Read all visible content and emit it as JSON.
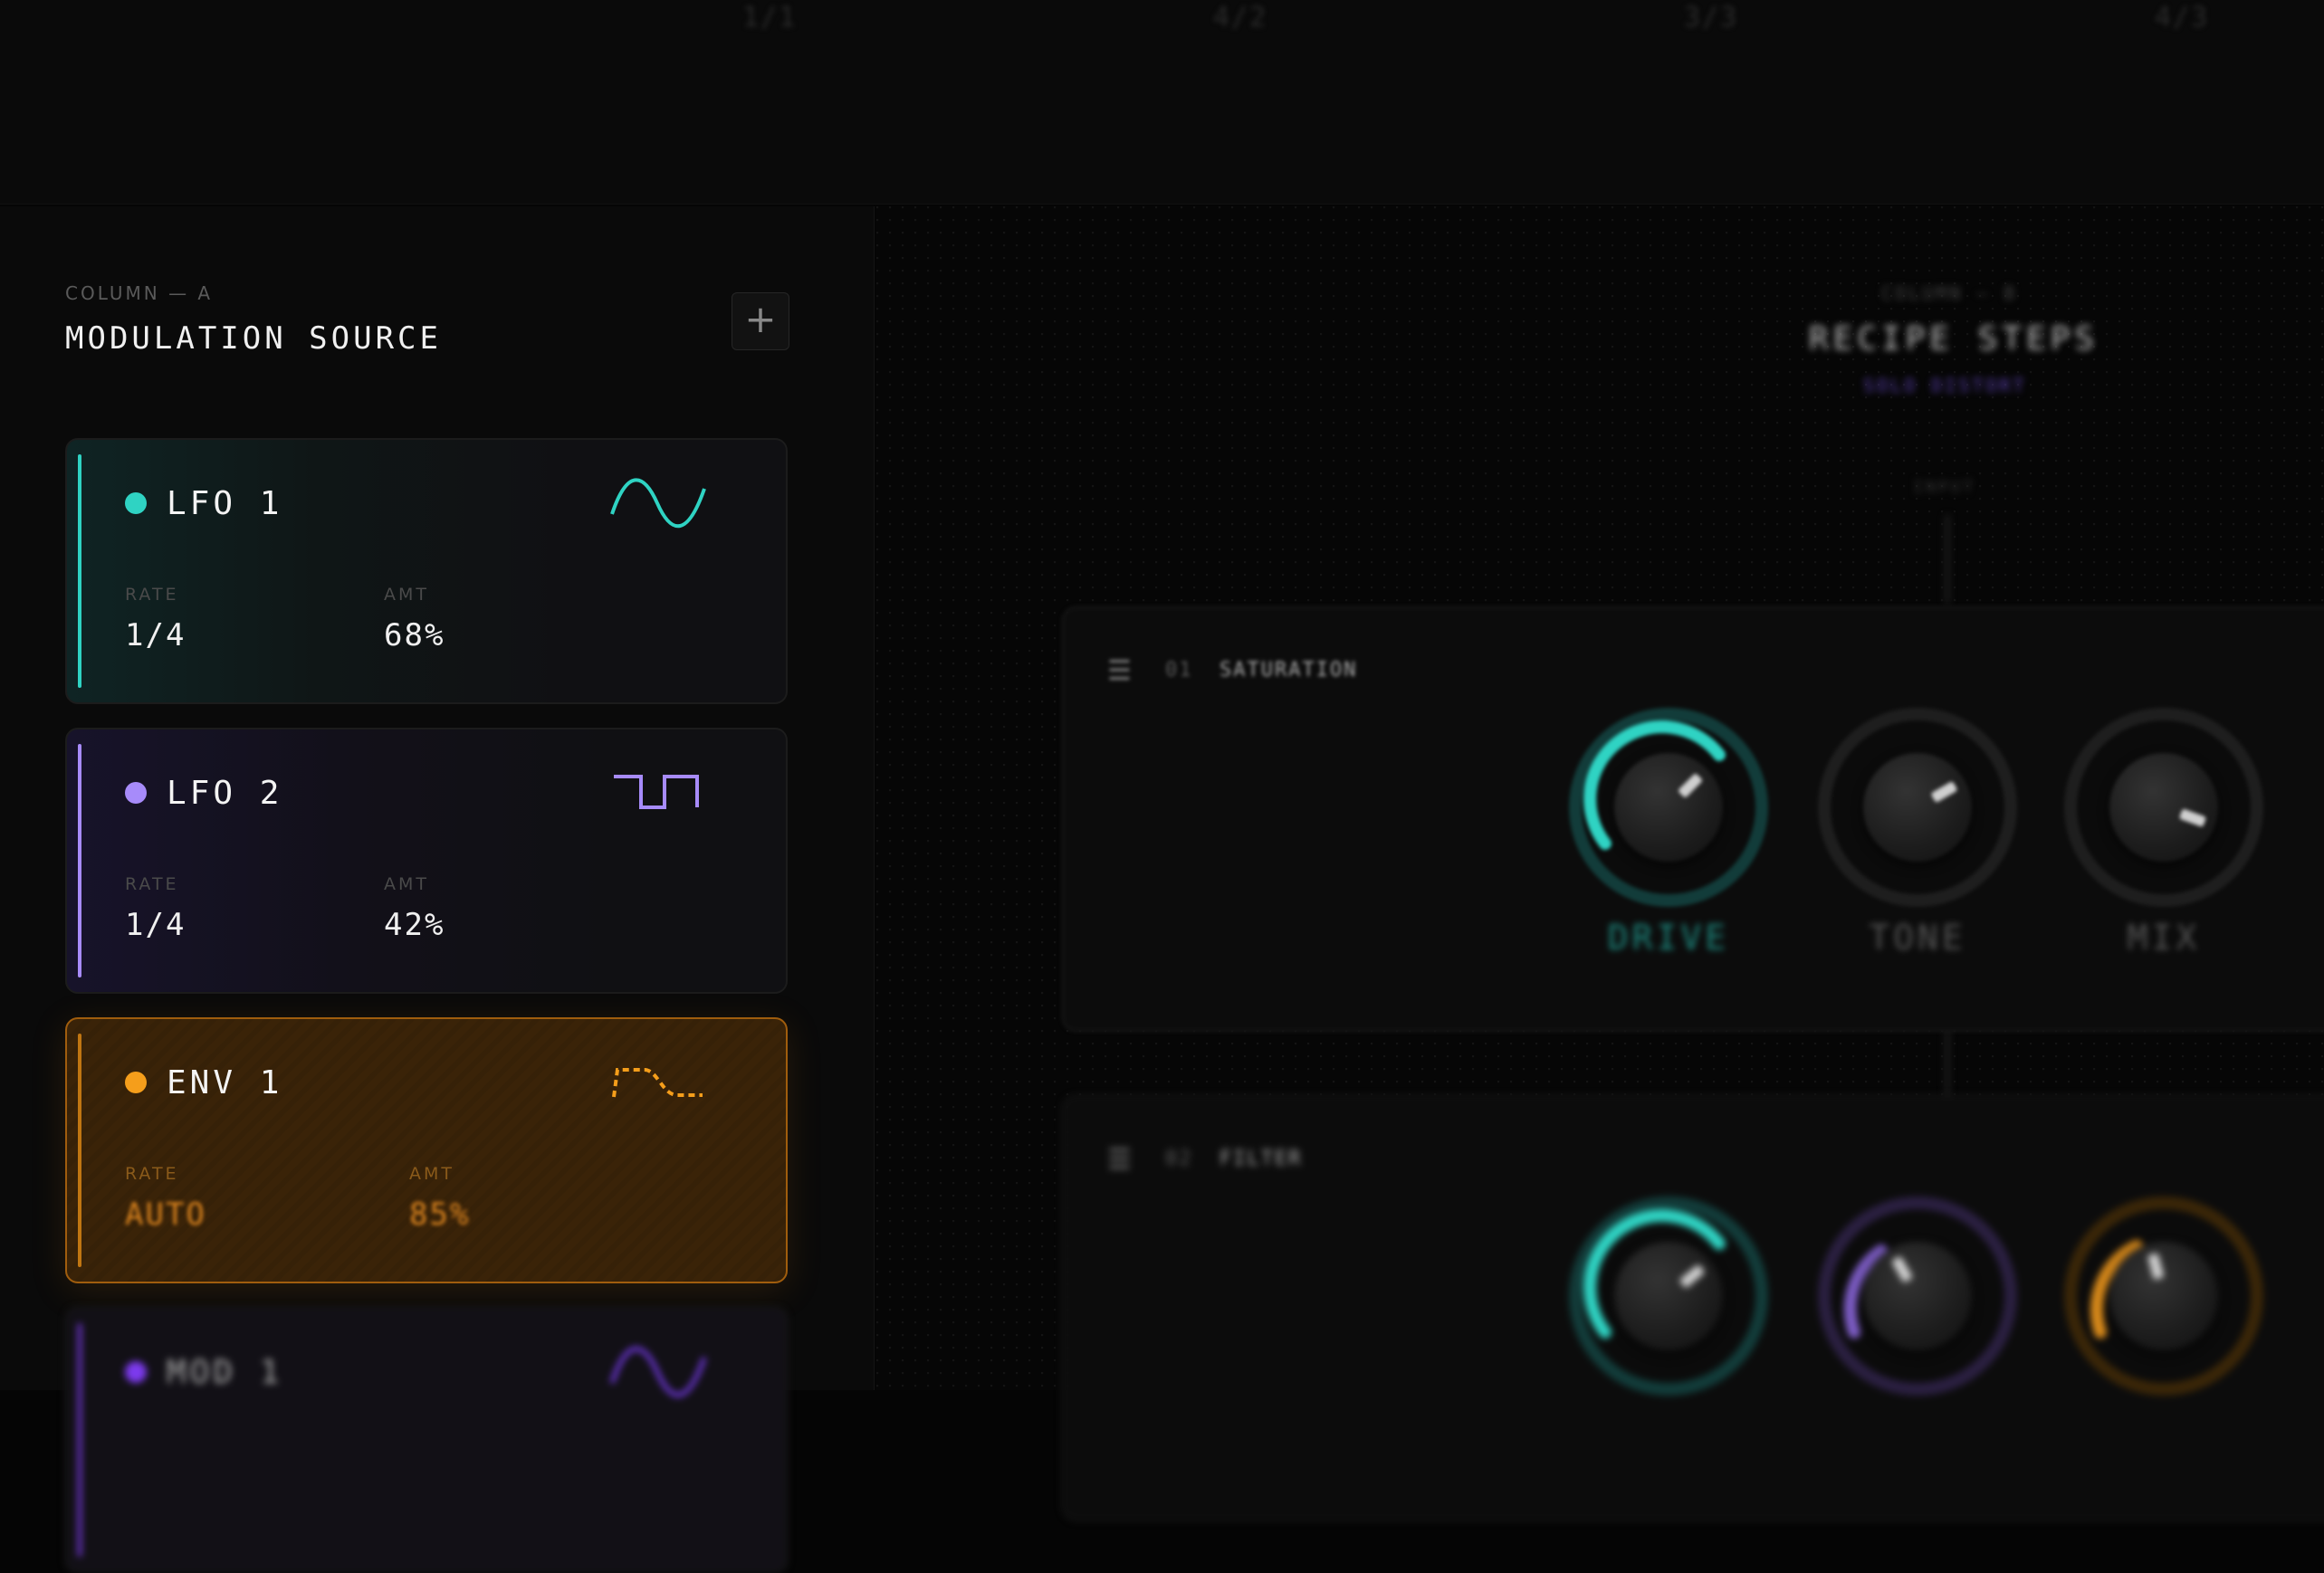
{
  "top_ruler": {
    "ticks": [
      "1/1",
      "4/2",
      "3/3",
      "4/3"
    ]
  },
  "column_a": {
    "label": "COLUMN — A",
    "title": "MODULATION SOURCE",
    "add_symbol": "+",
    "cards": [
      {
        "name": "LFO 1",
        "rate_label": "RATE",
        "rate": "1/4",
        "amt_label": "AMT",
        "amt": "68%",
        "color": "#2fd3c3",
        "wave": "sine-icon"
      },
      {
        "name": "LFO 2",
        "rate_label": "RATE",
        "rate": "1/4",
        "amt_label": "AMT",
        "amt": "42%",
        "color": "#a78bfa",
        "wave": "square-wave-icon"
      },
      {
        "name": "ENV 1",
        "rate_label": "RATE",
        "rate": "AUTO",
        "amt_label": "AMT",
        "amt": "85%",
        "color": "#f59e1b",
        "wave": "envelope-icon"
      },
      {
        "name": "MOD 1",
        "color": "#7c3aed",
        "wave": "sine-icon"
      }
    ]
  },
  "column_b": {
    "label": "COLUMN — B",
    "title": "RECIPE STEPS",
    "subtitle": "SOLO DISTORT",
    "input_label": "INPUT",
    "steps": [
      {
        "number": "01",
        "name": "SATURATION",
        "knobs": [
          {
            "label": "DRIVE",
            "color": "#2fd3c3",
            "level": 0.65
          },
          {
            "label": "TONE",
            "color": "#3a3a3a",
            "level": 0
          },
          {
            "label": "MIX",
            "color": "#3a3a3a",
            "level": 0
          }
        ]
      },
      {
        "number": "02",
        "name": "FILTER",
        "knobs": [
          {
            "color": "#2fd3c3",
            "level": 0.6
          },
          {
            "color": "#7c5cc4",
            "level": 0.3
          },
          {
            "color": "#d98a1a",
            "level": 0.35
          }
        ]
      }
    ]
  },
  "colors": {
    "accent_teal": "#2fd3c3",
    "accent_purple": "#a78bfa",
    "accent_orange": "#f59e1b"
  }
}
